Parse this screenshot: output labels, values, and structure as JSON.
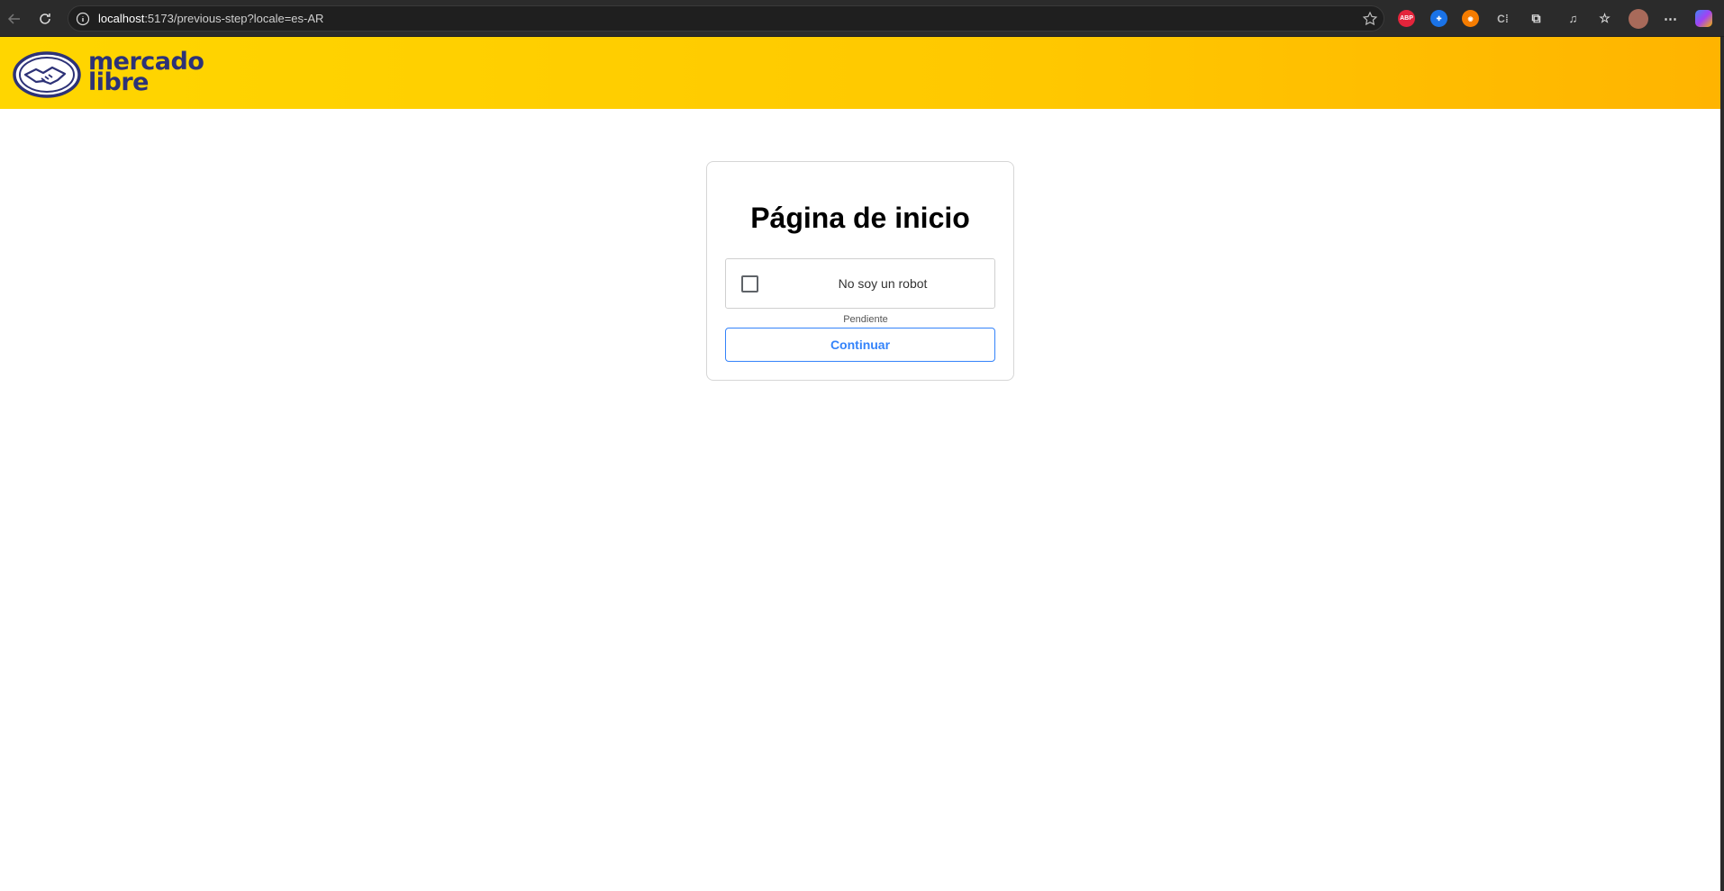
{
  "browser": {
    "url_host": "localhost",
    "url_rest": ":5173/previous-step?locale=es-AR",
    "extensions": [
      {
        "name": "adblock-plus-icon",
        "label": "ABP",
        "color": "#e4243b"
      },
      {
        "name": "extension-blue-icon",
        "label": "",
        "color": "#1a73e8"
      },
      {
        "name": "extension-orange-icon",
        "label": "",
        "color": "#f57c00"
      }
    ]
  },
  "header": {
    "logo_line1": "mercado",
    "logo_line2": "libre",
    "brand_color": "#ffe600",
    "logo_text_color": "#2d3277"
  },
  "card": {
    "title": "Página de inicio",
    "captcha_label": "No soy un robot",
    "status": "Pendiente",
    "continue_label": "Continuar",
    "accent_color": "#3483fa"
  }
}
